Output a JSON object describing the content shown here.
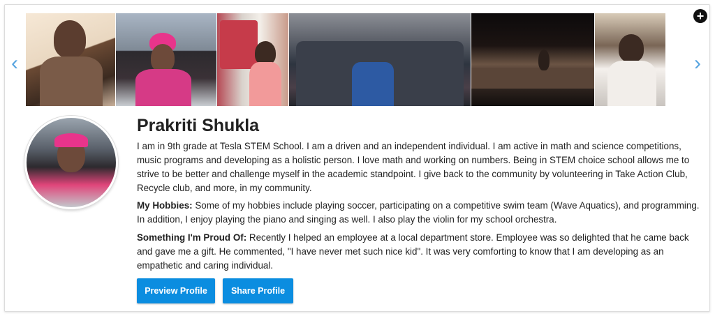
{
  "profile": {
    "name": "Prakriti Shukla",
    "bio": "I am in 9th grade at Tesla STEM School. I am a driven and an independent individual. I am active in math and science competitions, music programs and developing as a holistic person. I love math and working on numbers. Being in STEM choice school allows me to strive to be better and challenge myself in the academic standpoint. I give back to the community by volunteering in Take Action Club, Recycle club, and more, in my community.",
    "hobbies_label": "My Hobbies:",
    "hobbies_text": " Some of my hobbies include playing soccer, participating on a competitive swim team (Wave Aquatics), and programming. In addition, I enjoy playing the piano and singing as well. I also play the violin for my school orchestra.",
    "proud_label": "Something I'm Proud Of:",
    "proud_text": " Recently I helped an employee at a local department store. Employee was so delighted that he came back and gave me a gift. He commented, \"I have never met such nice kid\". It was very comforting to know that I am developing as an empathetic and caring individual."
  },
  "buttons": {
    "preview": "Preview Profile",
    "share": "Share Profile"
  },
  "carousel": {
    "prev_icon": "chevron-left-icon",
    "next_icon": "chevron-right-icon",
    "add_icon": "plus-circle-icon",
    "photo_count": 6
  },
  "colors": {
    "accent": "#0b8de0",
    "arrow": "#58a5e0"
  }
}
